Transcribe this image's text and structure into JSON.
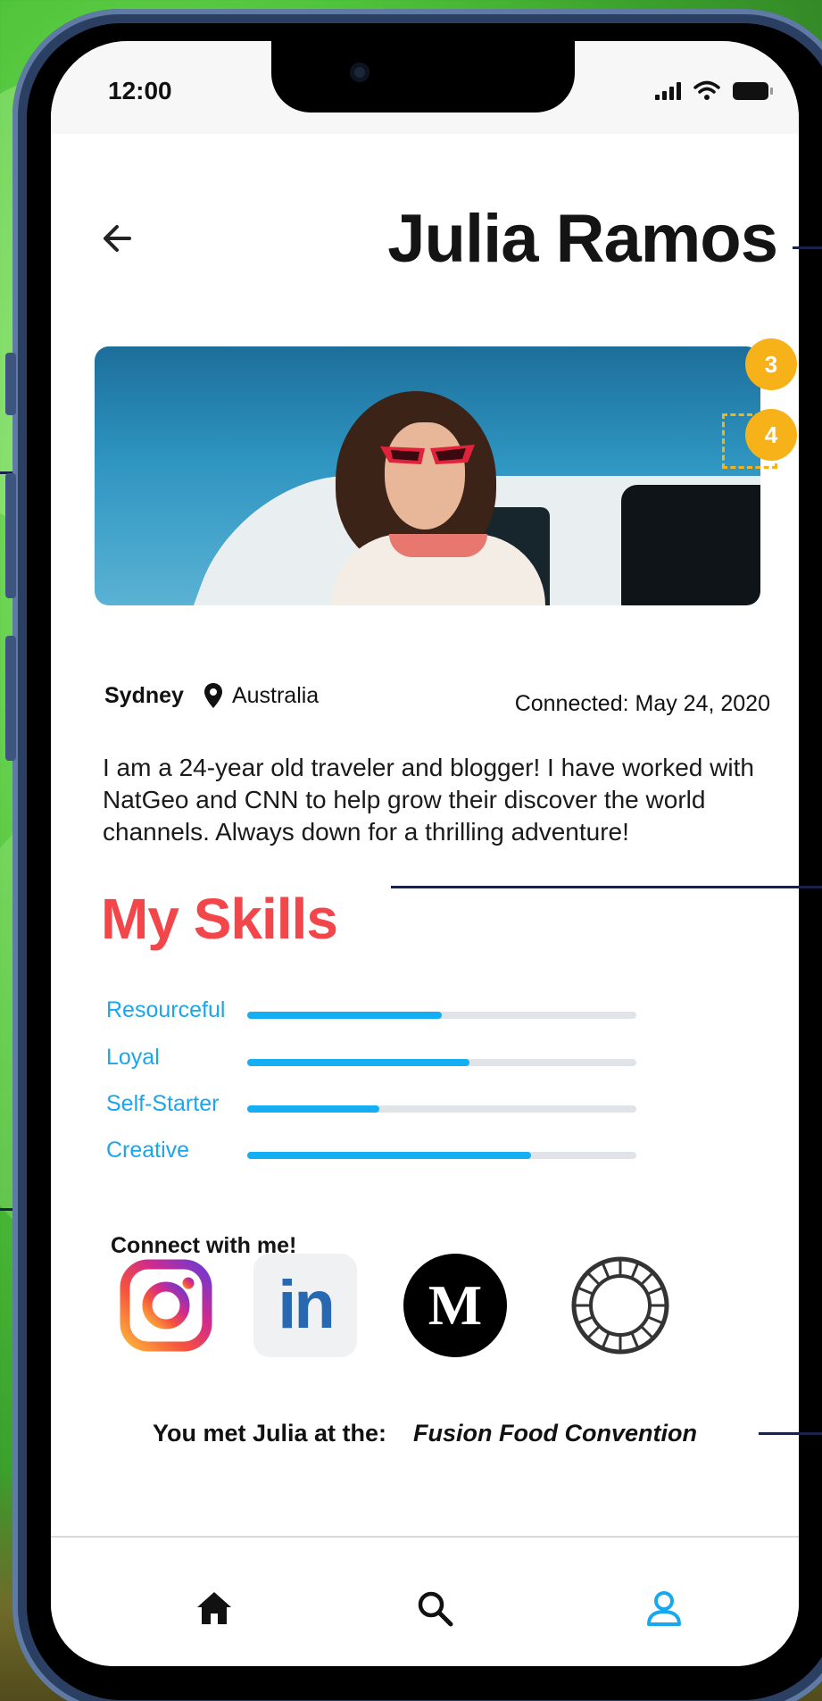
{
  "status_bar": {
    "time": "12:00"
  },
  "header": {
    "back_icon": "back-arrow-icon",
    "title": "Julia Ramos"
  },
  "hero": {
    "badges": [
      "3",
      "4"
    ]
  },
  "profile": {
    "city": "Sydney",
    "country": "Australia",
    "connected": "Connected: May 24, 2020",
    "bio": "I am a 24-year old traveler and blogger! I have worked with NatGeo and CNN to help grow their discover the world channels. Always down for a thrilling adventure!"
  },
  "skills": {
    "title": "My Skills",
    "items": [
      {
        "label": "Resourceful",
        "level": 0.5
      },
      {
        "label": "Loyal",
        "level": 0.57
      },
      {
        "label": "Self-Starter",
        "level": 0.34
      },
      {
        "label": "Creative",
        "level": 0.73
      }
    ]
  },
  "connect": {
    "title": "Connect with me!",
    "networks": [
      "instagram-icon",
      "linkedin-icon",
      "medium-icon",
      "vsco-icon"
    ],
    "linkedin_text": "in",
    "medium_text": "M"
  },
  "met": {
    "prefix": "You met Julia at the:",
    "event": "Fusion Food Convention"
  },
  "tabbar": {
    "items": [
      "home-icon",
      "search-icon",
      "profile-icon"
    ],
    "active_color": "#18a8ee"
  },
  "colors": {
    "skills_title": "#f2464a",
    "skill_bar": "#14aef3",
    "badge": "#f7b119"
  }
}
